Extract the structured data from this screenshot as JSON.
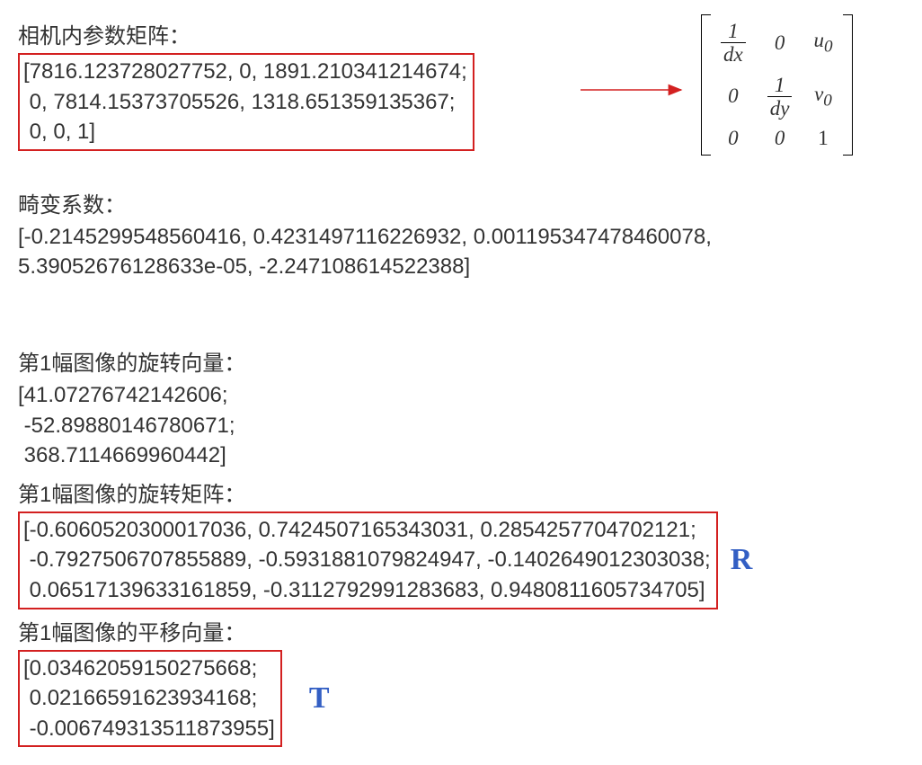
{
  "intrinsics": {
    "title": "相机内参数矩阵：",
    "matrix_text": "[7816.123728027752, 0, 1891.210341214674;\n 0, 7814.15373705526, 1318.651359135367;\n 0, 0, 1]"
  },
  "formula_matrix": {
    "r0c0_num": "1",
    "r0c0_den": "dx",
    "r0c1": "0",
    "r0c2": "u",
    "r0c2_sub": "0",
    "r1c0": "0",
    "r1c1_num": "1",
    "r1c1_den": "dy",
    "r1c2": "v",
    "r1c2_sub": "0",
    "r2c0": "0",
    "r2c1": "0",
    "r2c2": "1"
  },
  "distortion": {
    "title": "畸变系数：",
    "text": "[-0.2145299548560416, 0.4231497116226932, 0.001195347478460078, 5.39052676128633e-05, -2.247108614522388]"
  },
  "rot_vec": {
    "title": "第1幅图像的旋转向量：",
    "text": "[41.07276742142606;\n -52.89880146780671;\n 368.7114669960442]"
  },
  "rot_mat": {
    "title": "第1幅图像的旋转矩阵：",
    "text": "[-0.6060520300017036, 0.7424507165343031, 0.2854257704702121;\n -0.7927506707855889, -0.5931881079824947, -0.1402649012303038;\n 0.06517139633161859, -0.3112792991283683, 0.9480811605734705]",
    "label": "R"
  },
  "trans_vec": {
    "title": "第1幅图像的平移向量：",
    "text": "[0.03462059150275668;\n 0.02166591623934168;\n -0.006749313511873955]",
    "label": "T"
  }
}
